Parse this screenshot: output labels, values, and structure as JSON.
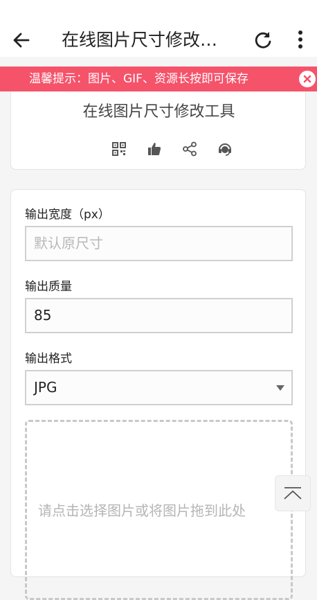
{
  "topbar": {
    "title": "在线图片尺寸修改…",
    "back_icon": "arrow-left-icon",
    "refresh_icon": "refresh-icon",
    "more_icon": "more-vertical-icon"
  },
  "notice": {
    "text": "温馨提示：图片、GIF、资源长按即可保存",
    "background": "#f5536a"
  },
  "tool": {
    "title": "在线图片尺寸修改工具",
    "actions": [
      "qrcode-icon",
      "thumbs-up-icon",
      "share-icon",
      "support-icon"
    ]
  },
  "form": {
    "width_label": "输出宽度（px）",
    "width_placeholder": "默认原尺寸",
    "quality_label": "输出质量",
    "quality_value": "85",
    "format_label": "输出格式",
    "format_value": "JPG",
    "dropzone_hint": "请点击选择图片或将图片拖到此处"
  },
  "scroll_top_icon": "chevron-up-icon"
}
